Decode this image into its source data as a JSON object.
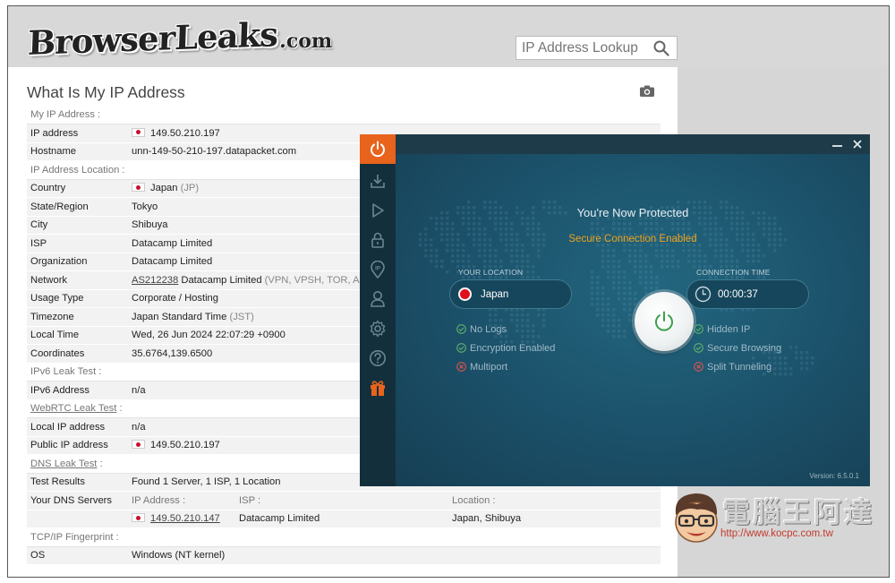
{
  "site": {
    "logo_text": "BrowserLeaks",
    "logo_tld": ".com",
    "search_placeholder": "IP Address Lookup"
  },
  "page": {
    "title": "What Is My IP Address"
  },
  "sections": {
    "my_ip": "My IP Address :",
    "location": "IP Address Location :",
    "ipv6": "IPv6 Leak Test :",
    "webrtc": "WebRTC Leak Test",
    "webrtc_colon": " :",
    "dns": "DNS Leak Test",
    "dns_colon": " :",
    "tcpip": "TCP/IP Fingerprint :"
  },
  "rows": {
    "ip_address": {
      "label": "IP address",
      "value": "149.50.210.197"
    },
    "hostname": {
      "label": "Hostname",
      "value": "unn-149-50-210-197.datapacket.com"
    },
    "country": {
      "label": "Country",
      "value": "Japan",
      "extra": "(JP)"
    },
    "state": {
      "label": "State/Region",
      "value": "Tokyo"
    },
    "city": {
      "label": "City",
      "value": "Shibuya"
    },
    "isp": {
      "label": "ISP",
      "value": "Datacamp Limited"
    },
    "organization": {
      "label": "Organization",
      "value": "Datacamp Limited"
    },
    "network": {
      "label": "Network",
      "value": "AS212238",
      "value2": "Datacamp Limited",
      "extra": "(VPN, VPSH, TOR, ANYC"
    },
    "usage_type": {
      "label": "Usage Type",
      "value": "Corporate / Hosting"
    },
    "timezone": {
      "label": "Timezone",
      "value": "Japan Standard Time",
      "extra": "(JST)"
    },
    "local_time": {
      "label": "Local Time",
      "value": "Wed, 26 Jun 2024 22:07:29 +0900"
    },
    "coordinates": {
      "label": "Coordinates",
      "value": "35.6764,139.6500"
    },
    "ipv6_address": {
      "label": "IPv6 Address",
      "value": "n/a"
    },
    "local_ip": {
      "label": "Local IP address",
      "value": "n/a"
    },
    "public_ip": {
      "label": "Public IP address",
      "value": "149.50.210.197"
    },
    "test_results": {
      "label": "Test Results",
      "value": "Found 1 Server, 1 ISP, 1 Location"
    },
    "dns_servers": {
      "label": "Your DNS Servers",
      "col_ip": "IP Address :",
      "col_isp": "ISP :",
      "col_location": "Location :",
      "ip": "149.50.210.147",
      "isp": "Datacamp Limited",
      "location": "Japan, Shibuya"
    },
    "os": {
      "label": "OS",
      "value": "Windows (NT kernel)"
    }
  },
  "vpn": {
    "title": "You're Now Protected",
    "subtitle": "Secure Connection Enabled",
    "your_location_label": "YOUR LOCATION",
    "location": "Japan",
    "connection_time_label": "CONNECTION TIME",
    "connection_time": "00:00:37",
    "left_features": [
      {
        "label": "No Logs",
        "status": "ok"
      },
      {
        "label": "Encryption Enabled",
        "status": "ok"
      },
      {
        "label": "Multiport",
        "status": "off"
      }
    ],
    "right_features": [
      {
        "label": "Hidden IP",
        "status": "ok"
      },
      {
        "label": "Secure Browsing",
        "status": "ok"
      },
      {
        "label": "Split Tunneling",
        "status": "off"
      }
    ],
    "version": "Version: 6.5.0.1",
    "sidebar_icons": [
      "power-icon",
      "download-icon",
      "play-icon",
      "lock-icon",
      "ip-pin-icon",
      "user-icon",
      "gear-icon",
      "help-icon",
      "gift-icon"
    ],
    "colors": {
      "accent": "#e8631c",
      "subtitle": "#f0a21a",
      "ok": "#5fb06a",
      "off": "#d9534f",
      "power": "#3aa04a"
    }
  },
  "watermark": {
    "text": "電腦王阿達",
    "url": "http://www.kocpc.com.tw"
  }
}
